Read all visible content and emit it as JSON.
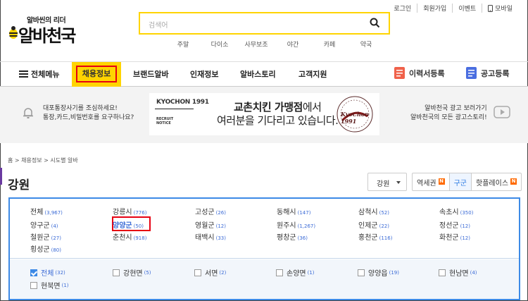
{
  "header": {
    "top_links": [
      "로그인",
      "회원가입",
      "이벤트",
      "모바일"
    ],
    "logo_slogan": "알바씬의 리더",
    "logo_name": "알바천국",
    "search_placeholder": "검색어",
    "categories": [
      "주말",
      "다이소",
      "사무보조",
      "야간",
      "카페",
      "약국"
    ]
  },
  "nav": {
    "menu_label": "전체메뉴",
    "items": [
      "채용정보",
      "브랜드알바",
      "인재정보",
      "알바스토리",
      "고객지원"
    ],
    "active": "채용정보",
    "resume_label": "이력서등록",
    "ad_label": "공고등록",
    "colors": {
      "accent": "#ffd400",
      "highlight": "#e60012",
      "resume": "#f0614a",
      "ad": "#4a6ee0"
    }
  },
  "banner": {
    "warning_lines": [
      "대포통장사기를 조심하세요!",
      "통장,카드,비밀번호를 요구하나요?"
    ],
    "ad_brand": "KYOCHON 1991",
    "ad_sub": [
      "RECRUIT",
      "NOTICE"
    ],
    "ad_copy_bold1": "교촌치킨 가맹점",
    "ad_copy_rest1": "에서",
    "ad_copy_line2": "여러분을 기다리고 있습니다.",
    "ad_seal": "KyoChon 1991",
    "promo_lines": [
      "알바천국 광고 보러가기",
      "알바천국의 모든 광고스토리!"
    ]
  },
  "breadcrumb": "홈 > 채용정보 > 시도별 알바",
  "page_title": "강원",
  "region_select": "강원",
  "tabs": [
    {
      "label": "역세권",
      "new": true
    },
    {
      "label": "구군",
      "new": false
    },
    {
      "label": "핫플레이스",
      "new": true
    }
  ],
  "new_badge": "N",
  "cities": [
    {
      "name": "전체",
      "count": "(3,967)"
    },
    {
      "name": "강릉시",
      "count": "(776)"
    },
    {
      "name": "고성군",
      "count": "(26)"
    },
    {
      "name": "동해시",
      "count": "(147)"
    },
    {
      "name": "삼척시",
      "count": "(52)"
    },
    {
      "name": "속초시",
      "count": "(350)"
    },
    {
      "name": "양구군",
      "count": "(4)"
    },
    {
      "name": "양양군",
      "count": "(50)"
    },
    {
      "name": "영월군",
      "count": "(12)"
    },
    {
      "name": "원주시",
      "count": "(1,267)"
    },
    {
      "name": "인제군",
      "count": "(22)"
    },
    {
      "name": "정선군",
      "count": "(12)"
    },
    {
      "name": "철원군",
      "count": "(27)"
    },
    {
      "name": "춘천시",
      "count": "(918)"
    },
    {
      "name": "태백시",
      "count": "(33)"
    },
    {
      "name": "평창군",
      "count": "(36)"
    },
    {
      "name": "홍천군",
      "count": "(116)"
    },
    {
      "name": "화천군",
      "count": "(12)"
    },
    {
      "name": "횡성군",
      "count": "(80)"
    }
  ],
  "selected_city": "양양군",
  "towns": [
    {
      "name": "전체",
      "count": "(32)",
      "checked": true
    },
    {
      "name": "강현면",
      "count": "(5)",
      "checked": false
    },
    {
      "name": "서면",
      "count": "(2)",
      "checked": false
    },
    {
      "name": "손양면",
      "count": "(1)",
      "checked": false
    },
    {
      "name": "양양읍",
      "count": "(19)",
      "checked": false
    },
    {
      "name": "현남면",
      "count": "(4)",
      "checked": false
    },
    {
      "name": "현북면",
      "count": "(1)",
      "checked": false
    }
  ]
}
